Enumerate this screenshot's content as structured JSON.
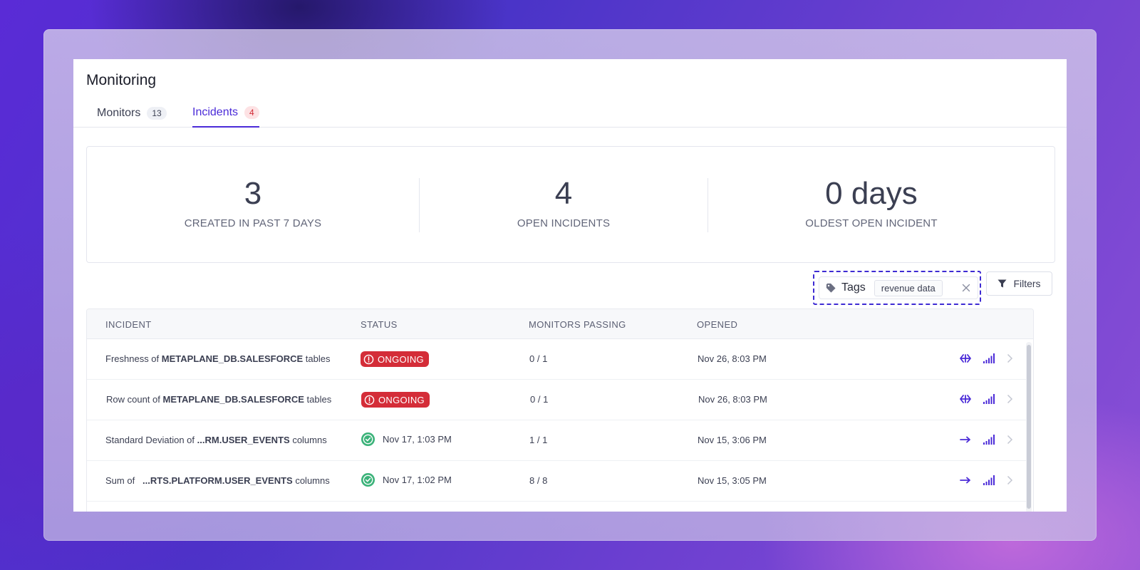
{
  "page": {
    "title": "Monitoring"
  },
  "tabs": [
    {
      "label": "Monitors",
      "count": "13"
    },
    {
      "label": "Incidents",
      "count": "4"
    }
  ],
  "stats": [
    {
      "value": "3",
      "label": "CREATED IN PAST 7 DAYS"
    },
    {
      "value": "4",
      "label": "OPEN INCIDENTS"
    },
    {
      "value": "0 days",
      "label": "OLDEST OPEN INCIDENT"
    }
  ],
  "filters": {
    "tags_label": "Tags",
    "tag_value": "revenue data",
    "filters_label": "Filters"
  },
  "table": {
    "columns": [
      "INCIDENT",
      "STATUS",
      "MONITORS PASSING",
      "OPENED"
    ],
    "rows": [
      {
        "prefix": "Freshness of",
        "entity": "METAPLANE_DB.SALESFORCE",
        "suffix": "tables",
        "status": "ONGOING",
        "status_type": "ongoing",
        "passing": "0 / 1",
        "opened": "Nov 26, 8:03 PM"
      },
      {
        "prefix": "Row count of",
        "entity": "METAPLANE_DB.SALESFORCE",
        "suffix": "tables",
        "status": "ONGOING",
        "status_type": "ongoing",
        "passing": "0 / 1",
        "opened": "Nov 26, 8:03 PM"
      },
      {
        "prefix": "Standard Deviation of",
        "entity": "...RM.USER_EVENTS",
        "suffix": "columns",
        "status": "Nov 17, 1:03 PM",
        "status_type": "resolved",
        "passing": "1 / 1",
        "opened": "Nov 15, 3:06 PM"
      },
      {
        "prefix": "Sum of",
        "entity": "...RTS.PLATFORM.USER_EVENTS",
        "suffix": "columns",
        "status": "Nov 17, 1:02 PM",
        "status_type": "resolved",
        "passing": "8 / 8",
        "opened": "Nov 15, 3:05 PM"
      }
    ]
  },
  "icons": {
    "tag": "tag-icon",
    "clear": "close-icon",
    "filter": "filter-icon",
    "alert": "alert-circle-icon",
    "check": "check-circle-icon",
    "lineage": "lineage-icon",
    "signal": "signal-bars-icon",
    "chevron": "chevron-right-icon"
  },
  "colors": {
    "accent": "#4b2bd8",
    "danger": "#d42d38",
    "success": "#3cb37a",
    "tab_badge_active": "#fde2e4"
  }
}
